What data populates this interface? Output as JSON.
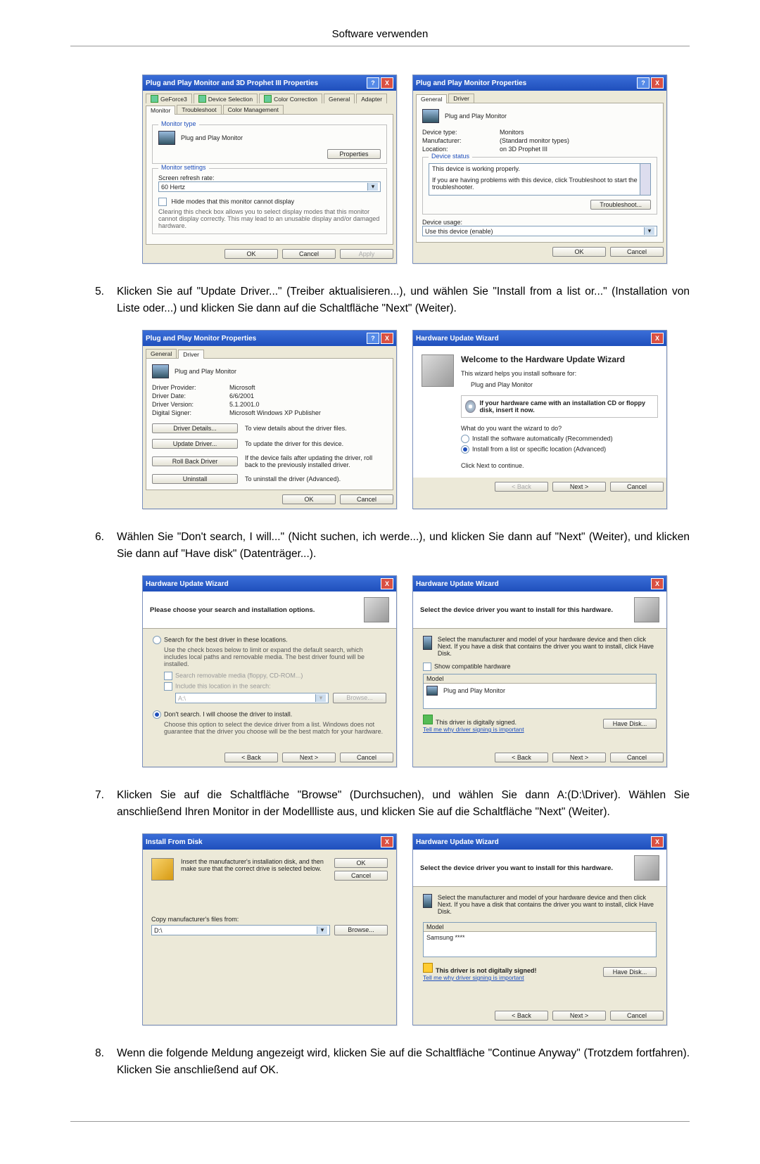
{
  "page_title": "Software verwenden",
  "steps": {
    "s5": "Klicken Sie auf \"Update Driver...\" (Treiber aktualisieren...), und wählen Sie \"Install from a list or...\" (Installation von Liste oder...) und klicken Sie dann auf die Schaltfläche \"Next\" (Weiter).",
    "s6": "Wählen Sie \"Don't search, I will...\" (Nicht suchen, ich werde...), und klicken Sie dann auf \"Next\" (Weiter), und klicken Sie dann auf \"Have disk\" (Datenträger...).",
    "s7": "Klicken Sie auf die Schaltfläche \"Browse\" (Durchsuchen), und wählen Sie dann A:(D:\\Driver). Wählen Sie anschließend Ihren Monitor in der Modellliste aus, und klicken Sie auf die Schaltfläche \"Next\" (Weiter).",
    "s8": "Wenn die folgende Meldung angezeigt wird, klicken Sie auf die Schaltfläche \"Continue Anyway\" (Trotzdem fortfahren). Klicken Sie anschließend auf OK."
  },
  "common_buttons": {
    "ok": "OK",
    "cancel": "Cancel",
    "apply": "Apply",
    "back": "< Back",
    "next": "Next >",
    "browse": "Browse...",
    "have_disk": "Have Disk...",
    "troubleshoot": "Troubleshoot...",
    "properties": "Properties"
  },
  "dlg1": {
    "title": "Plug and Play Monitor and 3D Prophet III Properties",
    "tabs": [
      "GeForce3",
      "Device Selection",
      "Color Correction",
      "General",
      "Adapter",
      "Monitor",
      "Troubleshoot",
      "Color Management"
    ],
    "monitor_type_label": "Monitor type",
    "monitor_type_value": "Plug and Play Monitor",
    "monitor_settings_label": "Monitor settings",
    "refresh_label": "Screen refresh rate:",
    "refresh_value": "60 Hertz",
    "hide_modes_check": "Hide modes that this monitor cannot display",
    "hide_modes_note": "Clearing this check box allows you to select display modes that this monitor cannot display correctly. This may lead to an unusable display and/or damaged hardware."
  },
  "dlg2": {
    "title": "Plug and Play Monitor Properties",
    "tabs": [
      "General",
      "Driver"
    ],
    "heading": "Plug and Play Monitor",
    "rows": {
      "device_type_k": "Device type:",
      "device_type_v": "Monitors",
      "manufacturer_k": "Manufacturer:",
      "manufacturer_v": "(Standard monitor types)",
      "location_k": "Location:",
      "location_v": "on 3D Prophet III"
    },
    "device_status_label": "Device status",
    "status_text": "This device is working properly.",
    "status_help": "If you are having problems with this device, click Troubleshoot to start the troubleshooter.",
    "device_usage_label": "Device usage:",
    "device_usage_value": "Use this device (enable)"
  },
  "dlg3": {
    "title": "Plug and Play Monitor Properties",
    "tabs": [
      "General",
      "Driver"
    ],
    "heading": "Plug and Play Monitor",
    "rows": {
      "provider_k": "Driver Provider:",
      "provider_v": "Microsoft",
      "date_k": "Driver Date:",
      "date_v": "6/6/2001",
      "version_k": "Driver Version:",
      "version_v": "5.1.2001.0",
      "signer_k": "Digital Signer:",
      "signer_v": "Microsoft Windows XP Publisher"
    },
    "btns": {
      "details": "Driver Details...",
      "details_desc": "To view details about the driver files.",
      "update": "Update Driver...",
      "update_desc": "To update the driver for this device.",
      "rollback": "Roll Back Driver",
      "rollback_desc": "If the device fails after updating the driver, roll back to the previously installed driver.",
      "uninstall": "Uninstall",
      "uninstall_desc": "To uninstall the driver (Advanced)."
    }
  },
  "dlg4": {
    "title": "Hardware Update Wizard",
    "welcome_title": "Welcome to the Hardware Update Wizard",
    "desc1": "This wizard helps you install software for:",
    "device": "Plug and Play Monitor",
    "cd_hint": "If your hardware came with an installation CD or floppy disk, insert it now.",
    "question": "What do you want the wizard to do?",
    "opt_auto": "Install the software automatically (Recommended)",
    "opt_list": "Install from a list or specific location (Advanced)",
    "continue": "Click Next to continue."
  },
  "dlg5": {
    "title": "Hardware Update Wizard",
    "header": "Please choose your search and installation options.",
    "opt_search": "Search for the best driver in these locations.",
    "opt_search_desc": "Use the check boxes below to limit or expand the default search, which includes local paths and removable media. The best driver found will be installed.",
    "chk_removable": "Search removable media (floppy, CD-ROM...)",
    "chk_include": "Include this location in the search:",
    "path_value": "A:\\",
    "opt_dont": "Don't search. I will choose the driver to install.",
    "opt_dont_desc": "Choose this option to select the device driver from a list. Windows does not guarantee that the driver you choose will be the best match for your hardware."
  },
  "dlg6": {
    "title": "Hardware Update Wizard",
    "header": "Select the device driver you want to install for this hardware.",
    "desc": "Select the manufacturer and model of your hardware device and then click Next. If you have a disk that contains the driver you want to install, click Have Disk.",
    "show_compat": "Show compatible hardware",
    "model_label": "Model",
    "model_value": "Plug and Play Monitor",
    "signed": "This driver is digitally signed.",
    "why_link": "Tell me why driver signing is important"
  },
  "dlg7": {
    "title": "Install From Disk",
    "desc": "Insert the manufacturer's installation disk, and then make sure that the correct drive is selected below.",
    "copy_from_label": "Copy manufacturer's files from:",
    "path_value": "D:\\"
  },
  "dlg8": {
    "title": "Hardware Update Wizard",
    "header": "Select the device driver you want to install for this hardware.",
    "desc": "Select the manufacturer and model of your hardware device and then click Next. If you have a disk that contains the driver you want to install, click Have Disk.",
    "model_label": "Model",
    "model_value": "Samsung ****",
    "not_signed": "This driver is not digitally signed!",
    "why_link": "Tell me why driver signing is important"
  }
}
